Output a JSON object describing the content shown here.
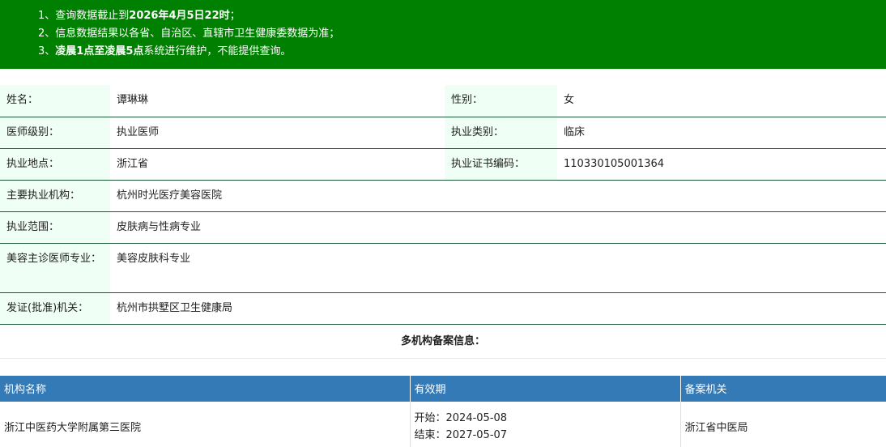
{
  "notice": {
    "line1_prefix": "1、查询数据截止到",
    "line1_bold": "2026年4月5日22时",
    "line1_suffix": "；",
    "line2": "2、信息数据结果以各省、自治区、直辖市卫生健康委数据为准；",
    "line3_prefix": "3、",
    "line3_bold": "凌晨1点至凌晨5点",
    "line3_suffix": "系统进行维护，不能提供查询。"
  },
  "doctor": {
    "name_label": "姓名：",
    "name": "谭琳琳",
    "gender_label": "性别：",
    "gender": "女",
    "level_label": "医师级别：",
    "level": "执业医师",
    "category_label": "执业类别：",
    "category": "临床",
    "location_label": "执业地点：",
    "location": "浙江省",
    "cert_label": "执业证书编码：",
    "cert": "110330105001364",
    "org_label": "主要执业机构：",
    "org": "杭州时光医疗美容医院",
    "scope_label": "执业范围：",
    "scope": "皮肤病与性病专业",
    "cosmetic_label": "美容主诊医师专业：",
    "cosmetic": "美容皮肤科专业",
    "issuer_label": "发证(批准)机关：",
    "issuer": "杭州市拱墅区卫生健康局"
  },
  "multi_title": "多机构备案信息：",
  "org_table": {
    "headers": [
      "机构名称",
      "有效期",
      "备案机关"
    ],
    "rows": [
      {
        "name": "浙江中医药大学附属第三医院",
        "start": "开始：2024-05-08",
        "end": "结束：2027-05-07",
        "authority": "浙江省中医局"
      }
    ]
  }
}
